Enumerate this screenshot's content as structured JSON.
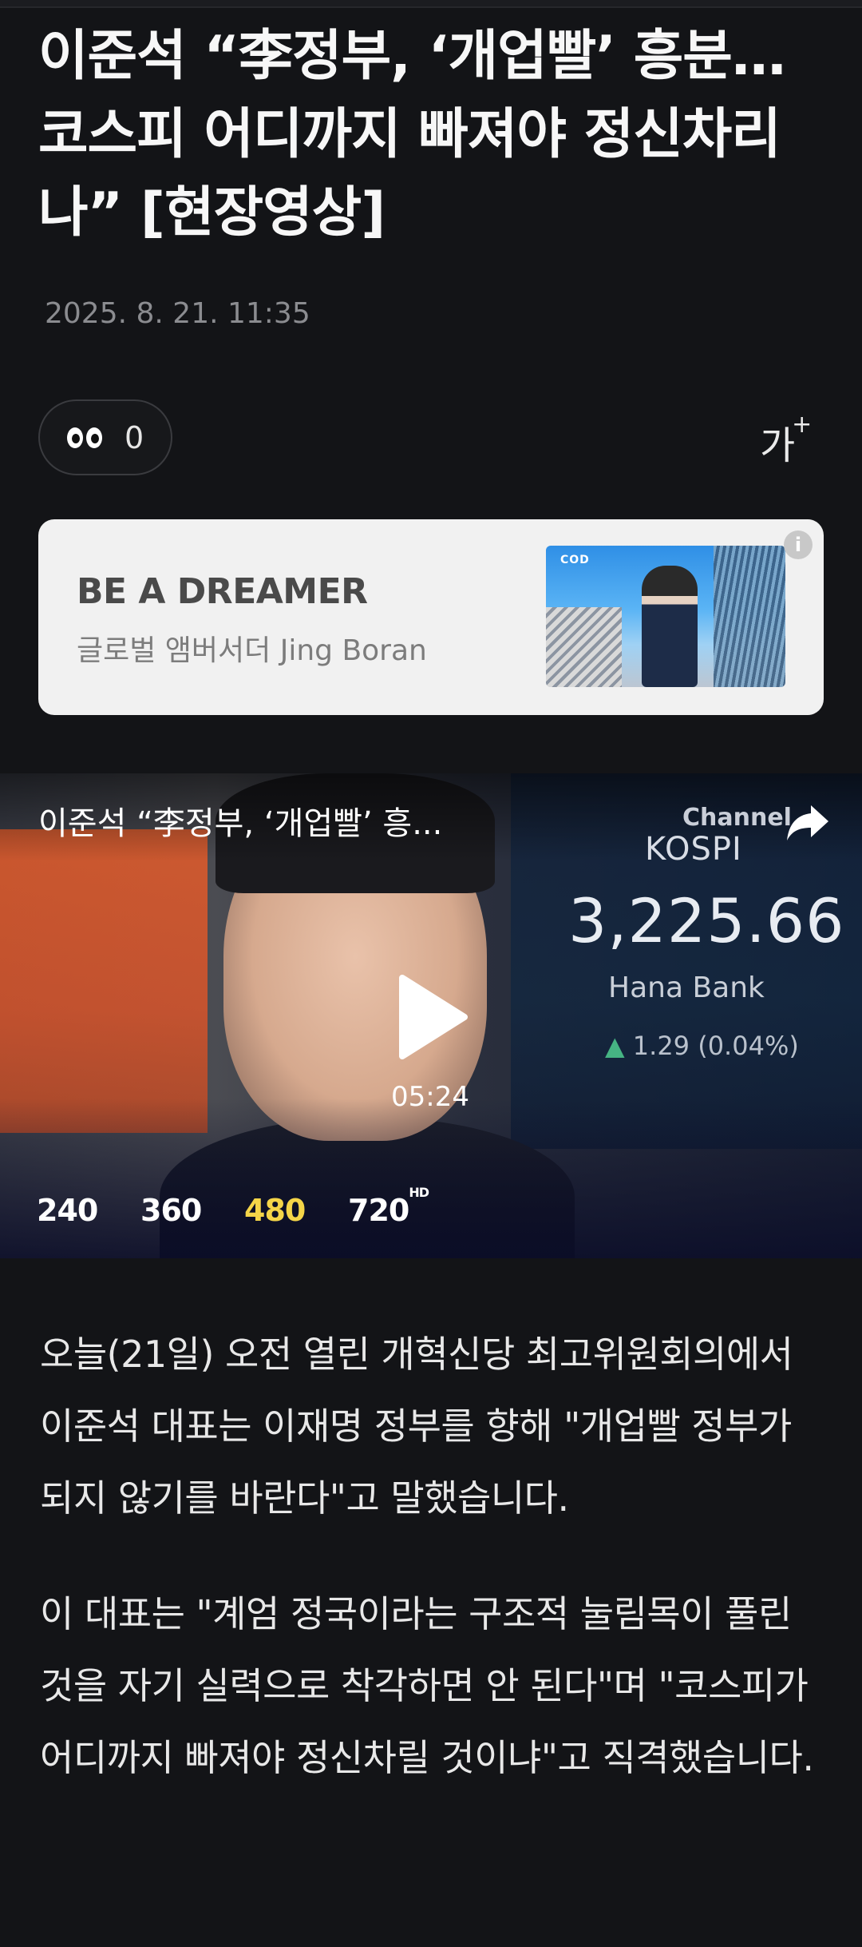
{
  "article": {
    "headline": "이준석 “李정부, ‘개업빨’ 흥분…코스피 어디까지 빠져야 정신차리나” [현장영상]",
    "date": "2025. 8. 21. 11:35",
    "view_count": "0",
    "font_size_label": "가",
    "font_size_plus": "+"
  },
  "ad": {
    "title": "BE A DREAMER",
    "subtitle": "글로벌 앰버서더 Jing Boran",
    "image_logo": "COD",
    "info_icon": "i"
  },
  "video": {
    "title": "이준석 “李정부, ‘개업빨’ 흥...",
    "duration": "05:24",
    "channel_label": "Channel",
    "kospi_label": "KOSPI",
    "kospi_value": "3,225.66",
    "kospi_bank": "Hana Bank",
    "kospi_change": "1.29 (0.04%)",
    "quality_options": [
      {
        "label": "240",
        "sup": ""
      },
      {
        "label": "360",
        "sup": ""
      },
      {
        "label": "480",
        "sup": ""
      },
      {
        "label": "720",
        "sup": "HD"
      }
    ],
    "quality_selected": "480"
  },
  "body": {
    "paragraphs": [
      "오늘(21일) 오전 열린 개혁신당 최고위원회의에서 이준석 대표는 이재명 정부를 향해 \"개업빨 정부가 되지 않기를 바란다\"고 말했습니다.",
      "이 대표는 \"계엄 정국이라는 구조적 눌림목이 풀린 것을 자기 실력으로 착각하면 안 된다\"며 \"코스피가 어디까지 빠져야 정신차릴 것이냐\"고 직격했습니다."
    ]
  },
  "colors": {
    "background": "#131417",
    "selected_quality": "#f5d548",
    "kospi_up": "#46b483"
  }
}
